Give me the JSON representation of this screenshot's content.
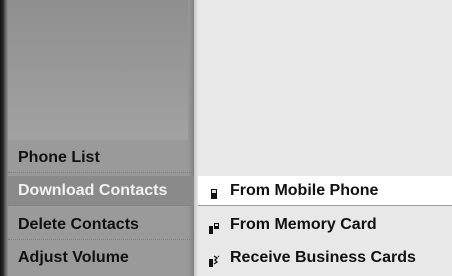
{
  "menu": {
    "items": [
      {
        "label": "Phone List"
      },
      {
        "label": "Download Contacts",
        "selected": true
      },
      {
        "label": "Delete Contacts"
      },
      {
        "label": "Adjust Volume"
      }
    ]
  },
  "submenu": {
    "items": [
      {
        "label": "From Mobile Phone",
        "icon": "mobile-phone-icon",
        "highlighted": true
      },
      {
        "label": "From Memory Card",
        "icon": "memory-card-icon"
      },
      {
        "label": "Receive Business Cards",
        "icon": "bluetooth-cards-icon"
      }
    ]
  },
  "colors": {
    "left_panel": "#9a9a9a",
    "selected_bg": "#8a8a8a",
    "selected_text": "#f2f2f2",
    "right_panel": "#e8e8e8",
    "highlight": "#ffffff"
  }
}
